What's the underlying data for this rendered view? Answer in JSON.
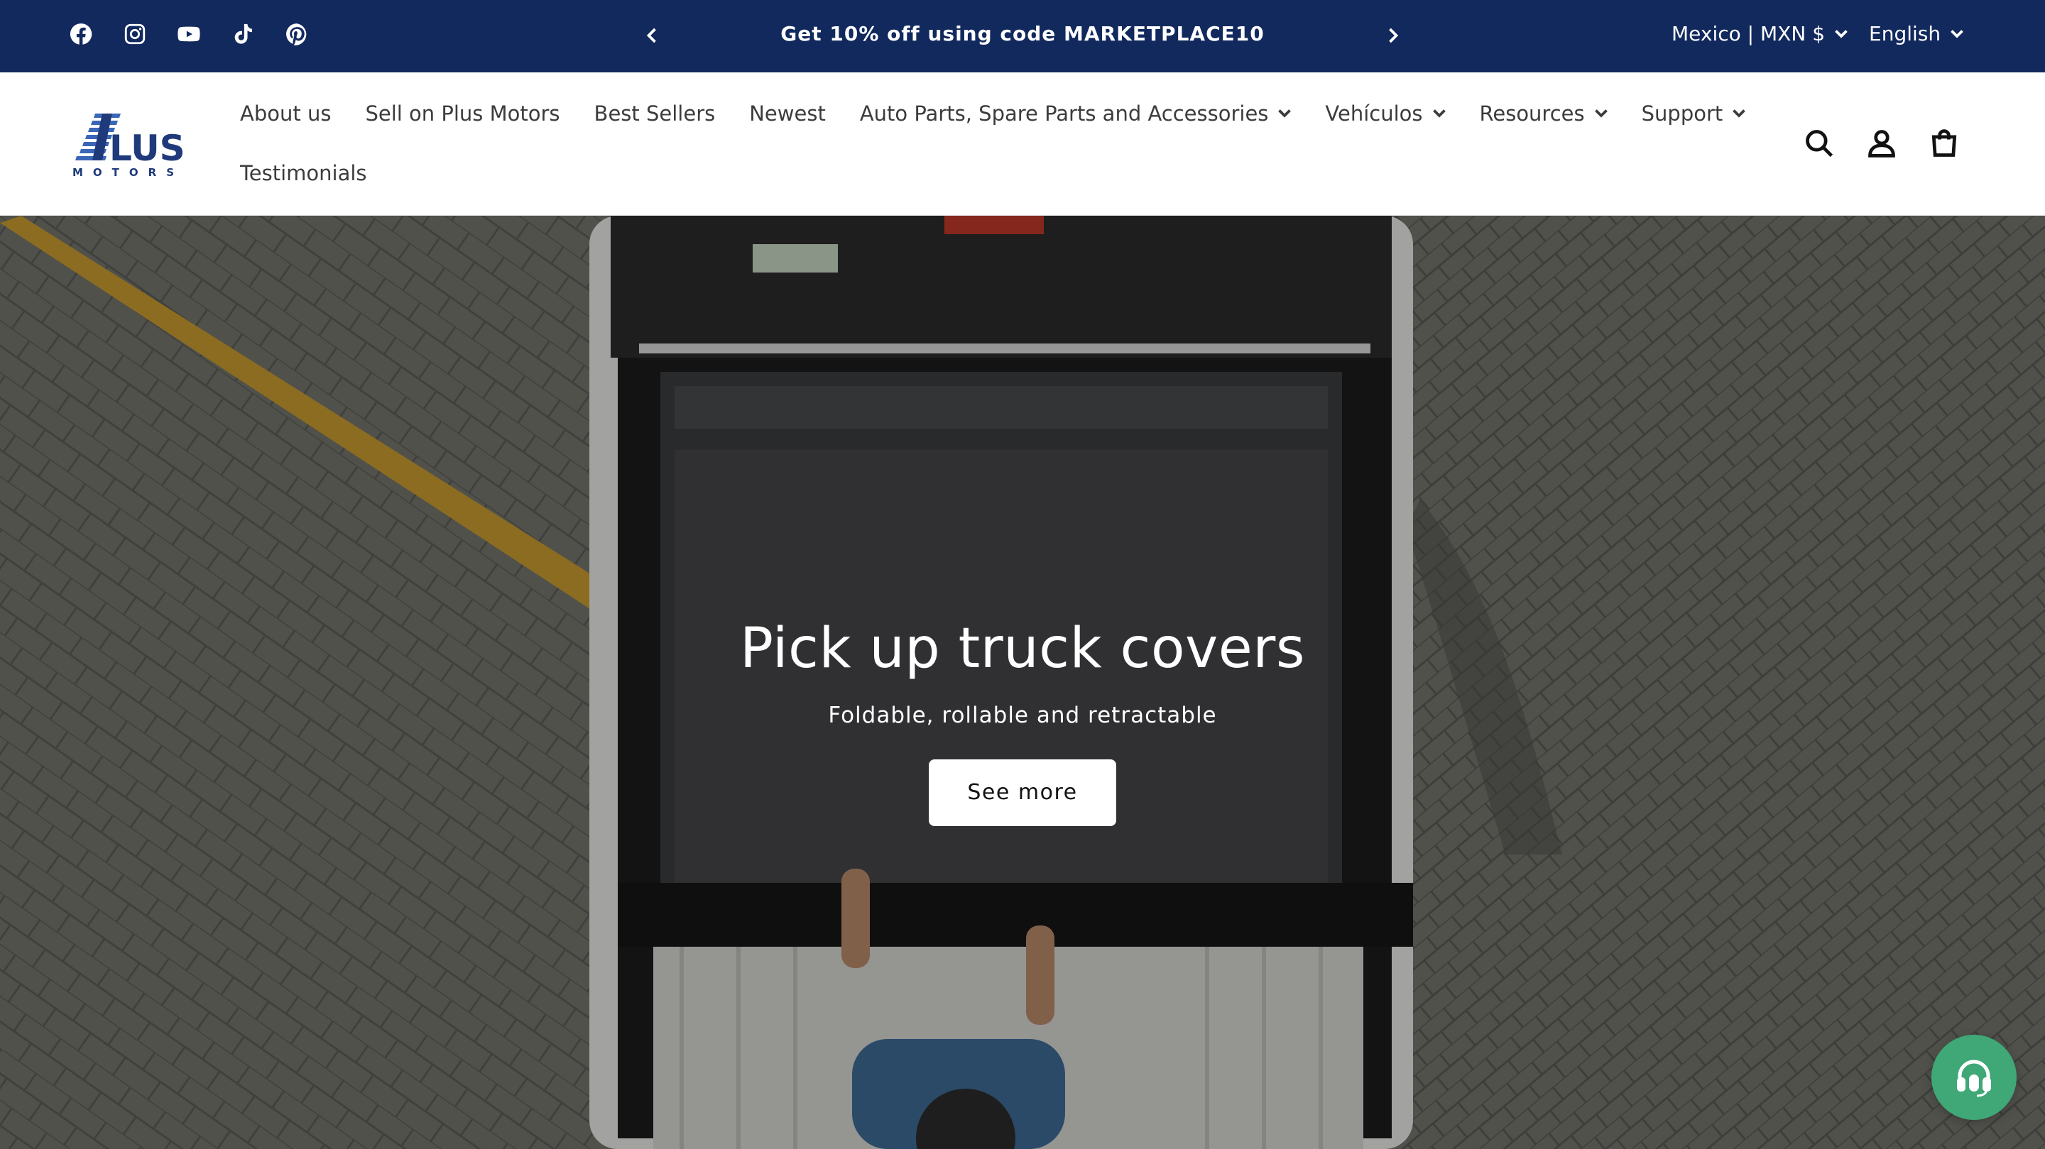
{
  "announcement": {
    "promo_text": "Get 10% off using code MARKETPLACE10",
    "country_selector": "Mexico | MXN $",
    "language_selector": "English",
    "background_color": "#12295e"
  },
  "social_icons": [
    "facebook-icon",
    "instagram-icon",
    "youtube-icon",
    "tiktok-icon",
    "pinterest-icon"
  ],
  "brand": {
    "logo_word": "LUS",
    "logo_sub": "MOTORS",
    "logo_color": "#1f3a7a"
  },
  "nav": {
    "items": [
      {
        "label": "About us",
        "has_dropdown": false
      },
      {
        "label": "Sell on Plus Motors",
        "has_dropdown": false
      },
      {
        "label": "Best Sellers",
        "has_dropdown": false
      },
      {
        "label": "Newest",
        "has_dropdown": false
      },
      {
        "label": "Auto Parts, Spare Parts and Accessories",
        "has_dropdown": true
      },
      {
        "label": "Vehículos",
        "has_dropdown": true
      },
      {
        "label": "Resources",
        "has_dropdown": true
      },
      {
        "label": "Support",
        "has_dropdown": true
      },
      {
        "label": "Testimonials",
        "has_dropdown": false
      }
    ]
  },
  "header_icons": [
    "search-icon",
    "account-icon",
    "cart-icon"
  ],
  "hero": {
    "title": "Pick up truck covers",
    "subtitle": "Foldable, rollable and retractable",
    "button_label": "See more"
  },
  "chat": {
    "icon": "headset-icon",
    "color": "#3fa876"
  }
}
